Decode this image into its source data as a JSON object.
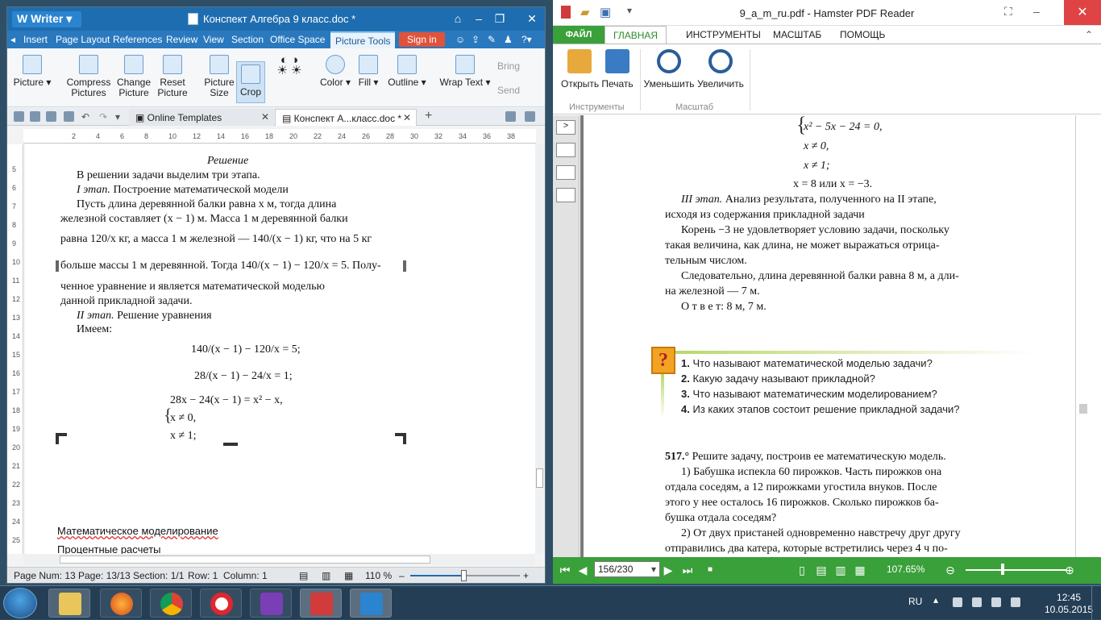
{
  "wps": {
    "app_name": "Writer",
    "doc_title": "Конспект Алгебра 9 класс.doc *",
    "menu": [
      "Insert",
      "Page Layout",
      "References",
      "Review",
      "View",
      "Section",
      "Office Space",
      "Picture Tools"
    ],
    "signin": "Sign in",
    "ribbon": {
      "picture": "Picture",
      "compress1": "Compress",
      "compress2": "Pictures",
      "change1": "Change",
      "change2": "Picture",
      "reset1": "Reset",
      "reset2": "Picture",
      "size1": "Picture",
      "size2": "Size",
      "crop": "Crop",
      "color": "Color",
      "fill": "Fill",
      "outline": "Outline",
      "wrap": "Wrap Text",
      "bring": "Bring",
      "send": "Send"
    },
    "tabs": {
      "online": "Online Templates",
      "doc": "Конспект А...класс.doc *"
    },
    "ruler": [
      "2",
      "4",
      "6",
      "8",
      "10",
      "12",
      "14",
      "16",
      "18",
      "20",
      "22",
      "24",
      "26",
      "28",
      "30",
      "32",
      "34",
      "36",
      "38"
    ],
    "vruler": [
      "5",
      "6",
      "7",
      "8",
      "9",
      "10",
      "11",
      "12",
      "13",
      "14",
      "15",
      "16",
      "17",
      "18",
      "19",
      "20",
      "21",
      "22",
      "23",
      "24",
      "25"
    ],
    "page": {
      "heading": "Решение",
      "l1": "В решении задачи выделим три этапа.",
      "l2a": "I этап.",
      "l2b": " Построение математической модели",
      "l3": "Пусть длина деревянной балки равна x м, тогда длина",
      "l4": "железной составляет (x − 1) м. Масса 1 м деревянной балки",
      "l5": "равна 120/x кг, а масса 1 м железной — 140/(x − 1) кг, что на 5 кг",
      "l6": "больше массы 1 м деревянной. Тогда 140/(x − 1) − 120/x = 5. Полу-",
      "l7": "ченное уравнение и является математической моделью",
      "l8": "данной прикладной задачи.",
      "l9a": "II этап.",
      "l9b": " Решение уравнения",
      "l10": "Имеем:",
      "e1": "140/(x − 1) − 120/x = 5;",
      "e2": "28/(x − 1) − 24/x = 1;",
      "e3": "28x − 24(x − 1) = x² − x,",
      "e4": "x ≠ 0,",
      "e5": "x ≠ 1;",
      "below1": "Математическое моделирование",
      "below2": "Процентные расчеты"
    },
    "status": {
      "page_num": "Page Num: 13",
      "page": "Page: 13/13",
      "section": "Section: 1/1",
      "row": "Row: 1",
      "column": "Column: 1",
      "zoom": "110 %"
    }
  },
  "pdf": {
    "title": "9_a_m_ru.pdf - Hamster PDF Reader",
    "menu": {
      "file": "ФАЙЛ",
      "home": "ГЛАВНАЯ",
      "tools": "ИНСТРУМЕНТЫ",
      "scale": "МАСШТАБ",
      "help": "ПОМОЩЬ"
    },
    "ribbon": {
      "open": "Открыть",
      "print": "Печать",
      "zoom_out": "Уменьшить",
      "zoom_in": "Увеличить",
      "group_tools": "Инструменты",
      "group_scale": "Масштаб"
    },
    "content": {
      "s1": "x² − 5x − 24 = 0,",
      "s2": "x ≠ 0,",
      "s3": "x ≠ 1;",
      "s4": "x = 8 или x = −3.",
      "p1a": "III этап.",
      "p1b": " Анализ результата, полученного на II этапе,",
      "p2": "исходя из содержания прикладной задачи",
      "p3": "Корень −3 не удовлетворяет условию задачи, поскольку",
      "p4": "такая величина, как длина, не может выражаться отрица-",
      "p5": "тельным числом.",
      "p6": "Следовательно, длина деревянной балки равна 8 м, а дли-",
      "p7": "на железной — 7 м.",
      "p8": "О т в е т: 8 м, 7 м.",
      "q1n": "1.",
      "q1": "Что называют математической моделью задачи?",
      "q2n": "2.",
      "q2": "Какую задачу называют прикладной?",
      "q3n": "3.",
      "q3": "Что называют математическим моделированием?",
      "q4n": "4.",
      "q4": "Из каких этапов состоит решение прикладной задачи?",
      "t1n": "517.°",
      "t1": " Решите задачу, построив ее математическую модель.",
      "t2": "1) Бабушка испекла 60 пирожков. Часть пирожков она",
      "t3": "отдала соседям, а 12 пирожками угостила внуков. После",
      "t4": "этого у нее осталось 16 пирожков. Сколько пирожков ба-",
      "t5": "бушка отдала соседям?",
      "t6": "2) От двух пристаней одновременно навстречу друг другу",
      "t7": "отправились два катера, которые встретились через 4 ч по-"
    },
    "page_box": "156/230",
    "zoom": "107.65%"
  },
  "taskbar": {
    "lang": "RU",
    "time": "12:45",
    "date": "10.05.2015"
  }
}
